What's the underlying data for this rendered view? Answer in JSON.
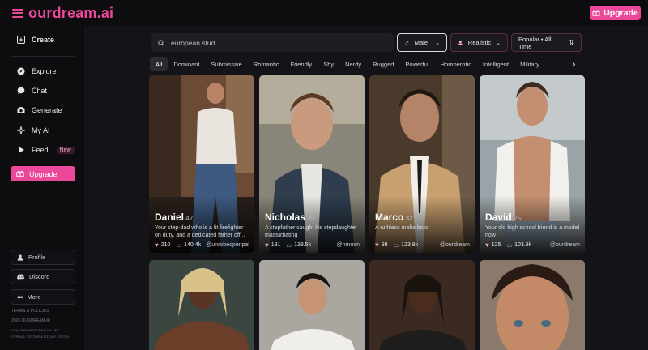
{
  "brand": {
    "logo": "ourdream.ai",
    "accent": "#ec4899"
  },
  "header": {
    "upgrade_label": "Upgrade"
  },
  "sidebar": {
    "create": "Create",
    "items": [
      "Explore",
      "Chat",
      "Generate",
      "My AI",
      "Feed"
    ],
    "feed_badge": "New",
    "upgrade_label": "Upgrade",
    "bottom": [
      "Profile",
      "Discord",
      "More"
    ],
    "footer": [
      "TERMS & POLICIES",
      "2025 OURDREAM.AI",
      "USA: DREAM STUDIO USA, INC.",
      "CYPRUS: TEXTORIA LTD (HE 475779)"
    ]
  },
  "search": {
    "value": "european stud"
  },
  "filters": {
    "gender": "Male",
    "style": "Realistic",
    "sort": "Popular • All Time"
  },
  "tabs": [
    "All",
    "Dominant",
    "Submissive",
    "Romantic",
    "Friendly",
    "Shy",
    "Nerdy",
    "Rugged",
    "Powerful",
    "Homoerotic",
    "Intelligent",
    "Military"
  ],
  "cards": [
    {
      "name": "Daniel",
      "age": "47",
      "desc": "Your step-dad who is a fit firefighter on duty, and a dedicated father off...",
      "likes": "210",
      "chats": "140.4k",
      "creator": "@unrobedpenpal"
    },
    {
      "name": "Nicholas",
      "age": "35",
      "desc": "A stepfather caught his stepdaughter masturbating",
      "likes": "191",
      "chats": "138.5k",
      "creator": "@hmmm"
    },
    {
      "name": "Marco",
      "age": "32",
      "desc": "A ruthless mafia boss",
      "likes": "98",
      "chats": "123.8k",
      "creator": "@ourdream"
    },
    {
      "name": "David",
      "age": "25",
      "desc": "Your old high school friend is a model now",
      "likes": "125",
      "chats": "103.9k",
      "creator": "@ourdream"
    }
  ]
}
